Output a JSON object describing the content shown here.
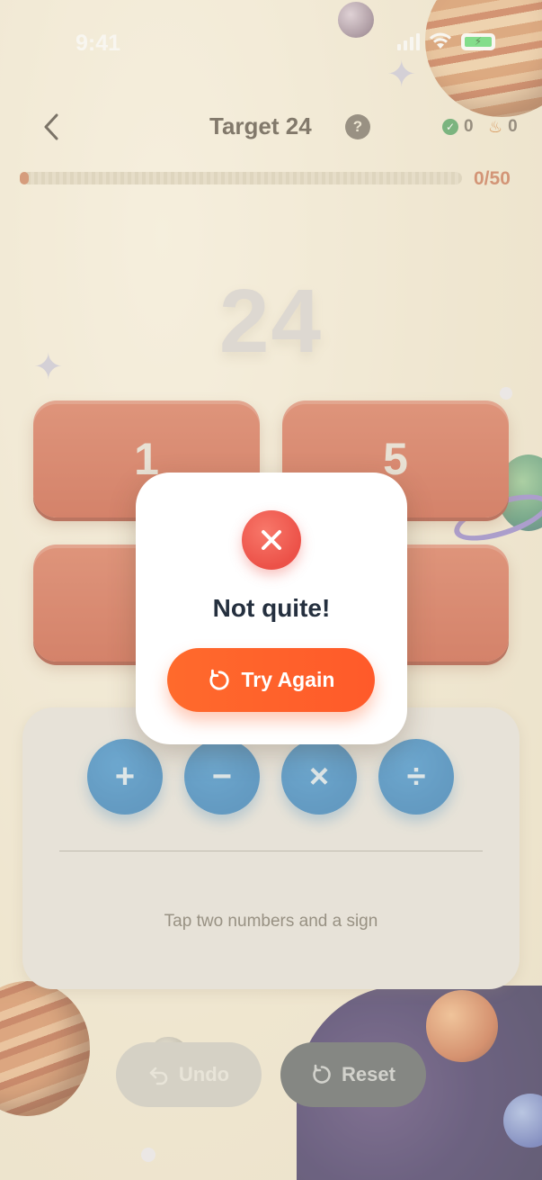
{
  "status_bar": {
    "time": "9:41"
  },
  "header": {
    "title": "Target 24",
    "help": "?",
    "correct_count": "0",
    "streak_count": "0"
  },
  "progress": {
    "label": "0/50",
    "fraction": 0.0
  },
  "game": {
    "target": "24",
    "numbers": [
      "1",
      "5",
      "",
      ""
    ]
  },
  "operators": [
    "+",
    "−",
    "×",
    "÷"
  ],
  "hint": "Tap two numbers and a sign",
  "actions": {
    "undo": "Undo",
    "reset": "Reset"
  },
  "modal": {
    "title": "Not quite!",
    "button": "Try Again"
  },
  "colors": {
    "accent": "#ff5a2a",
    "card": "#d05a3c",
    "operator": "#1b72b7",
    "error": "#ec5148"
  }
}
